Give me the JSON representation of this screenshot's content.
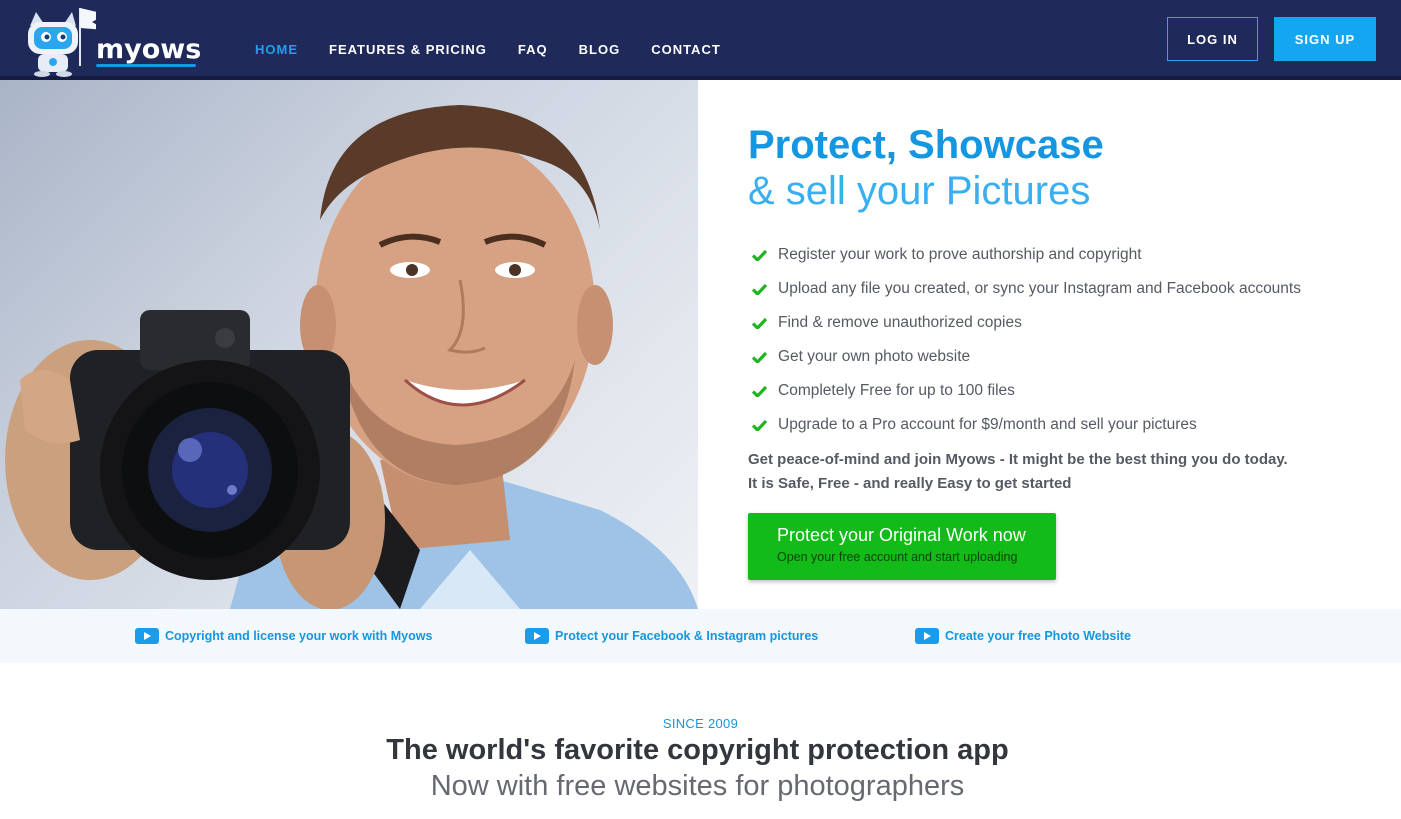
{
  "brand": {
    "name": "myows"
  },
  "nav": {
    "links": [
      "HOME",
      "FEATURES & PRICING",
      "FAQ",
      "BLOG",
      "CONTACT"
    ],
    "active": "HOME",
    "login": "LOG IN",
    "signup": "SIGN UP"
  },
  "hero": {
    "title": "Protect, Showcase",
    "subtitle": "& sell your Pictures",
    "features": [
      "Register your work to prove authorship and copyright",
      "Upload any file you created, or sync your Instagram and Facebook accounts",
      "Find & remove unauthorized copies",
      "Get your own photo website",
      "Completely Free for up to 100 files",
      "Upgrade to a Pro account for $9/month and sell your pictures"
    ],
    "tagline1": "Get peace-of-mind and join Myows - It might be the best thing you do today.",
    "tagline2": "It is Safe, Free - and really Easy to get started",
    "cta_main": "Protect your Original Work now",
    "cta_sub": "Open your free account and start uploading"
  },
  "video_links": [
    "Copyright and license your work with Myows",
    "Protect your Facebook & Instagram pictures",
    "Create your free Photo Website"
  ],
  "section": {
    "since": "SINCE 2009",
    "headline": "The world's favorite copyright protection app",
    "subheadline": "Now with free websites for photographers"
  },
  "colors": {
    "navbar": "#1f2a5a",
    "accent": "#1596e0",
    "cta": "#12bb17",
    "check": "#1fb51f"
  },
  "icons": [
    "robot-mascot-logo",
    "check-icon",
    "video-play-icon"
  ]
}
